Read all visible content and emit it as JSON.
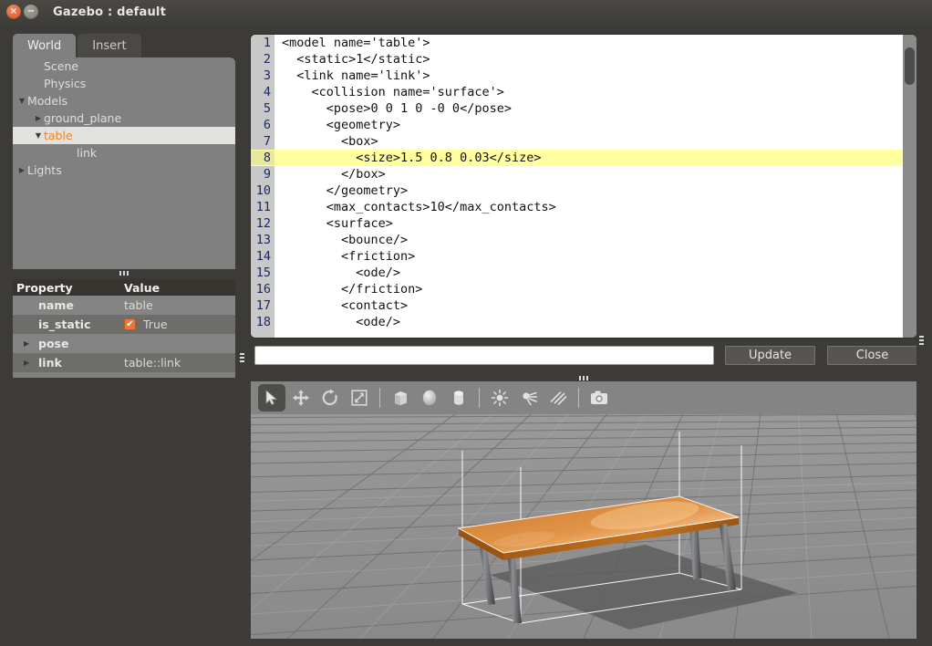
{
  "window": {
    "title": "Gazebo : default",
    "close_glyph": "×",
    "minimize_glyph": "−",
    "close_name": "close-icon",
    "minimize_name": "minimize-icon"
  },
  "tabs": [
    {
      "label": "World",
      "active": true
    },
    {
      "label": "Insert",
      "active": false
    }
  ],
  "tree": [
    {
      "label": "Scene",
      "indent": 1,
      "arrow": "",
      "selected": false
    },
    {
      "label": "Physics",
      "indent": 1,
      "arrow": "",
      "selected": false
    },
    {
      "label": "Models",
      "indent": 0,
      "arrow": "▼",
      "selected": false
    },
    {
      "label": "ground_plane",
      "indent": 1,
      "arrow": "▶",
      "selected": false
    },
    {
      "label": "table",
      "indent": 1,
      "arrow": "▼",
      "selected": true
    },
    {
      "label": "link",
      "indent": 3,
      "arrow": "",
      "selected": false
    },
    {
      "label": "Lights",
      "indent": 0,
      "arrow": "▶",
      "selected": false
    }
  ],
  "properties": {
    "headers": {
      "property": "Property",
      "value": "Value"
    },
    "rows": [
      {
        "name": "name",
        "value": "table",
        "arrow": "",
        "checkbox": false
      },
      {
        "name": "is_static",
        "value": "True",
        "arrow": "",
        "checkbox": true
      },
      {
        "name": "pose",
        "value": "",
        "arrow": "▶",
        "checkbox": false
      },
      {
        "name": "link",
        "value": "table::link",
        "arrow": "▶",
        "checkbox": false
      }
    ],
    "check_glyph": "✔"
  },
  "editor": {
    "lines": [
      {
        "n": "1",
        "text": "<model name='table'>",
        "highlight": false
      },
      {
        "n": "2",
        "text": "  <static>1</static>",
        "highlight": false
      },
      {
        "n": "3",
        "text": "  <link name='link'>",
        "highlight": false
      },
      {
        "n": "4",
        "text": "    <collision name='surface'>",
        "highlight": false
      },
      {
        "n": "5",
        "text": "      <pose>0 0 1 0 -0 0</pose>",
        "highlight": false
      },
      {
        "n": "6",
        "text": "      <geometry>",
        "highlight": false
      },
      {
        "n": "7",
        "text": "        <box>",
        "highlight": false
      },
      {
        "n": "8",
        "text": "          <size>1.5 0.8 0.03</size>",
        "highlight": true
      },
      {
        "n": "9",
        "text": "        </box>",
        "highlight": false
      },
      {
        "n": "10",
        "text": "      </geometry>",
        "highlight": false
      },
      {
        "n": "11",
        "text": "      <max_contacts>10</max_contacts>",
        "highlight": false
      },
      {
        "n": "12",
        "text": "      <surface>",
        "highlight": false
      },
      {
        "n": "13",
        "text": "        <bounce/>",
        "highlight": false
      },
      {
        "n": "14",
        "text": "        <friction>",
        "highlight": false
      },
      {
        "n": "15",
        "text": "          <ode/>",
        "highlight": false
      },
      {
        "n": "16",
        "text": "        </friction>",
        "highlight": false
      },
      {
        "n": "17",
        "text": "        <contact>",
        "highlight": false
      },
      {
        "n": "18",
        "text": "          <ode/>",
        "highlight": false
      }
    ],
    "highlight_color": "#ffffa0"
  },
  "command_bar": {
    "input_value": "",
    "input_placeholder": "",
    "update_label": "Update",
    "close_label": "Close"
  },
  "toolbar": [
    {
      "name": "select-arrow-icon",
      "active": true
    },
    {
      "name": "translate-move-icon",
      "active": false
    },
    {
      "name": "rotate-icon",
      "active": false
    },
    {
      "name": "scale-icon",
      "active": false
    },
    {
      "name": "separator",
      "active": false
    },
    {
      "name": "box-shape-icon",
      "active": false
    },
    {
      "name": "sphere-shape-icon",
      "active": false
    },
    {
      "name": "cylinder-shape-icon",
      "active": false
    },
    {
      "name": "separator",
      "active": false
    },
    {
      "name": "point-light-icon",
      "active": false
    },
    {
      "name": "spot-light-icon",
      "active": false
    },
    {
      "name": "directional-light-icon",
      "active": false
    },
    {
      "name": "separator",
      "active": false
    },
    {
      "name": "screenshot-camera-icon",
      "active": false
    }
  ],
  "viewport": {
    "scene_name": "gazebo-3d-scene",
    "model": "table",
    "ground_color": "#8f8f8f",
    "tabletop_color": "#d98836",
    "leg_color": "#6b6b6b",
    "selection_box_color": "#ffffff",
    "shadow_color": "#5c5c5c"
  },
  "colors": {
    "dock_background": "#3c3b37",
    "panel_background": "#808080",
    "accent_orange": "#e8862a",
    "titlebar": "#443f3a"
  }
}
